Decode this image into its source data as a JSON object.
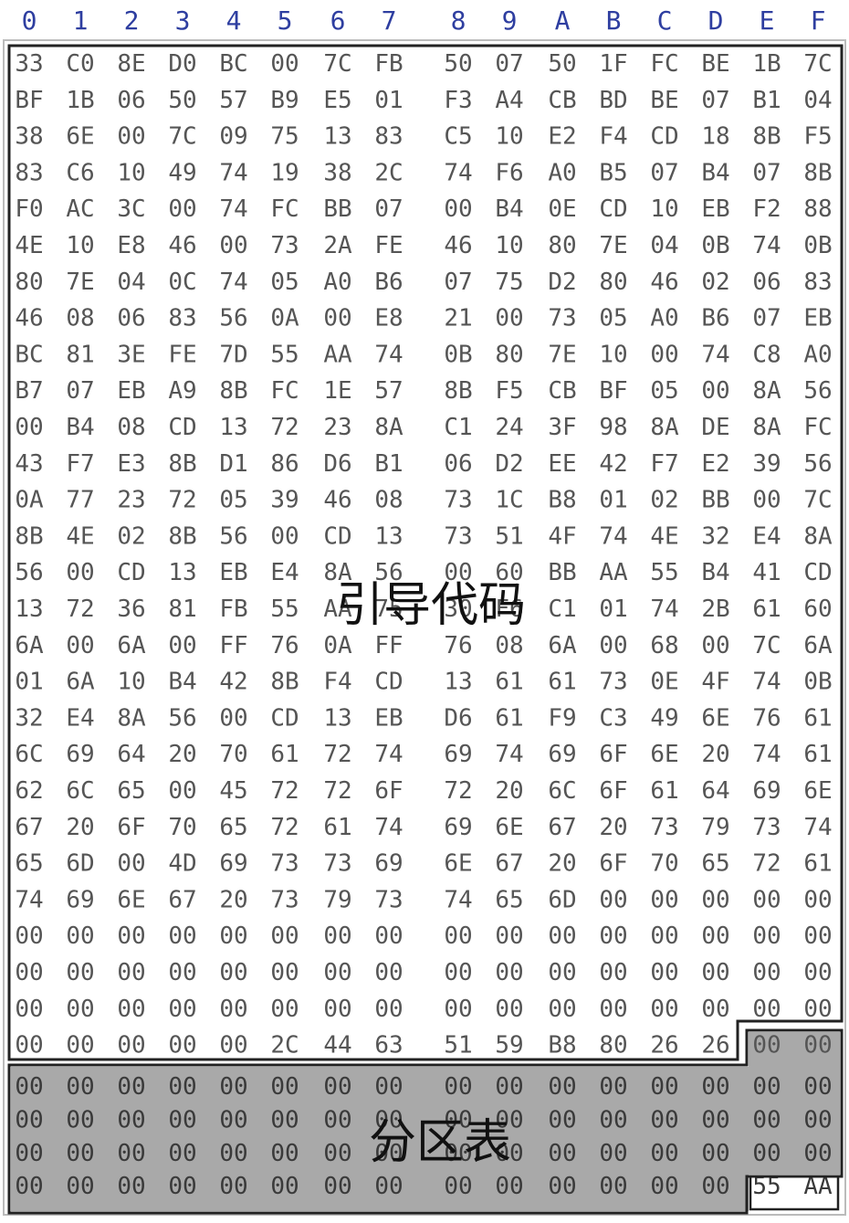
{
  "header": [
    "0",
    "1",
    "2",
    "3",
    "4",
    "5",
    "6",
    "7",
    "8",
    "9",
    "A",
    "B",
    "C",
    "D",
    "E",
    "F"
  ],
  "labels": {
    "boot_code": "引导代码",
    "partition_table": "分区表"
  },
  "rows": [
    [
      "33",
      "C0",
      "8E",
      "D0",
      "BC",
      "00",
      "7C",
      "FB",
      "50",
      "07",
      "50",
      "1F",
      "FC",
      "BE",
      "1B",
      "7C"
    ],
    [
      "BF",
      "1B",
      "06",
      "50",
      "57",
      "B9",
      "E5",
      "01",
      "F3",
      "A4",
      "CB",
      "BD",
      "BE",
      "07",
      "B1",
      "04"
    ],
    [
      "38",
      "6E",
      "00",
      "7C",
      "09",
      "75",
      "13",
      "83",
      "C5",
      "10",
      "E2",
      "F4",
      "CD",
      "18",
      "8B",
      "F5"
    ],
    [
      "83",
      "C6",
      "10",
      "49",
      "74",
      "19",
      "38",
      "2C",
      "74",
      "F6",
      "A0",
      "B5",
      "07",
      "B4",
      "07",
      "8B"
    ],
    [
      "F0",
      "AC",
      "3C",
      "00",
      "74",
      "FC",
      "BB",
      "07",
      "00",
      "B4",
      "0E",
      "CD",
      "10",
      "EB",
      "F2",
      "88"
    ],
    [
      "4E",
      "10",
      "E8",
      "46",
      "00",
      "73",
      "2A",
      "FE",
      "46",
      "10",
      "80",
      "7E",
      "04",
      "0B",
      "74",
      "0B"
    ],
    [
      "80",
      "7E",
      "04",
      "0C",
      "74",
      "05",
      "A0",
      "B6",
      "07",
      "75",
      "D2",
      "80",
      "46",
      "02",
      "06",
      "83"
    ],
    [
      "46",
      "08",
      "06",
      "83",
      "56",
      "0A",
      "00",
      "E8",
      "21",
      "00",
      "73",
      "05",
      "A0",
      "B6",
      "07",
      "EB"
    ],
    [
      "BC",
      "81",
      "3E",
      "FE",
      "7D",
      "55",
      "AA",
      "74",
      "0B",
      "80",
      "7E",
      "10",
      "00",
      "74",
      "C8",
      "A0"
    ],
    [
      "B7",
      "07",
      "EB",
      "A9",
      "8B",
      "FC",
      "1E",
      "57",
      "8B",
      "F5",
      "CB",
      "BF",
      "05",
      "00",
      "8A",
      "56"
    ],
    [
      "00",
      "B4",
      "08",
      "CD",
      "13",
      "72",
      "23",
      "8A",
      "C1",
      "24",
      "3F",
      "98",
      "8A",
      "DE",
      "8A",
      "FC"
    ],
    [
      "43",
      "F7",
      "E3",
      "8B",
      "D1",
      "86",
      "D6",
      "B1",
      "06",
      "D2",
      "EE",
      "42",
      "F7",
      "E2",
      "39",
      "56"
    ],
    [
      "0A",
      "77",
      "23",
      "72",
      "05",
      "39",
      "46",
      "08",
      "73",
      "1C",
      "B8",
      "01",
      "02",
      "BB",
      "00",
      "7C"
    ],
    [
      "8B",
      "4E",
      "02",
      "8B",
      "56",
      "00",
      "CD",
      "13",
      "73",
      "51",
      "4F",
      "74",
      "4E",
      "32",
      "E4",
      "8A"
    ],
    [
      "56",
      "00",
      "CD",
      "13",
      "EB",
      "E4",
      "8A",
      "56",
      "00",
      "60",
      "BB",
      "AA",
      "55",
      "B4",
      "41",
      "CD"
    ],
    [
      "13",
      "72",
      "36",
      "81",
      "FB",
      "55",
      "AA",
      "75",
      "30",
      "F6",
      "C1",
      "01",
      "74",
      "2B",
      "61",
      "60"
    ],
    [
      "6A",
      "00",
      "6A",
      "00",
      "FF",
      "76",
      "0A",
      "FF",
      "76",
      "08",
      "6A",
      "00",
      "68",
      "00",
      "7C",
      "6A"
    ],
    [
      "01",
      "6A",
      "10",
      "B4",
      "42",
      "8B",
      "F4",
      "CD",
      "13",
      "61",
      "61",
      "73",
      "0E",
      "4F",
      "74",
      "0B"
    ],
    [
      "32",
      "E4",
      "8A",
      "56",
      "00",
      "CD",
      "13",
      "EB",
      "D6",
      "61",
      "F9",
      "C3",
      "49",
      "6E",
      "76",
      "61"
    ],
    [
      "6C",
      "69",
      "64",
      "20",
      "70",
      "61",
      "72",
      "74",
      "69",
      "74",
      "69",
      "6F",
      "6E",
      "20",
      "74",
      "61"
    ],
    [
      "62",
      "6C",
      "65",
      "00",
      "45",
      "72",
      "72",
      "6F",
      "72",
      "20",
      "6C",
      "6F",
      "61",
      "64",
      "69",
      "6E"
    ],
    [
      "67",
      "20",
      "6F",
      "70",
      "65",
      "72",
      "61",
      "74",
      "69",
      "6E",
      "67",
      "20",
      "73",
      "79",
      "73",
      "74"
    ],
    [
      "65",
      "6D",
      "00",
      "4D",
      "69",
      "73",
      "73",
      "69",
      "6E",
      "67",
      "20",
      "6F",
      "70",
      "65",
      "72",
      "61"
    ],
    [
      "74",
      "69",
      "6E",
      "67",
      "20",
      "73",
      "79",
      "73",
      "74",
      "65",
      "6D",
      "00",
      "00",
      "00",
      "00",
      "00"
    ],
    [
      "00",
      "00",
      "00",
      "00",
      "00",
      "00",
      "00",
      "00",
      "00",
      "00",
      "00",
      "00",
      "00",
      "00",
      "00",
      "00"
    ],
    [
      "00",
      "00",
      "00",
      "00",
      "00",
      "00",
      "00",
      "00",
      "00",
      "00",
      "00",
      "00",
      "00",
      "00",
      "00",
      "00"
    ],
    [
      "00",
      "00",
      "00",
      "00",
      "00",
      "00",
      "00",
      "00",
      "00",
      "00",
      "00",
      "00",
      "00",
      "00",
      "00",
      "00"
    ],
    [
      "00",
      "00",
      "00",
      "00",
      "00",
      "2C",
      "44",
      "63",
      "51",
      "59",
      "B8",
      "80",
      "26",
      "26",
      "00",
      "00"
    ],
    [
      "00",
      "00",
      "00",
      "00",
      "00",
      "00",
      "00",
      "00",
      "00",
      "00",
      "00",
      "00",
      "00",
      "00",
      "00",
      "00"
    ],
    [
      "00",
      "00",
      "00",
      "00",
      "00",
      "00",
      "00",
      "00",
      "00",
      "00",
      "00",
      "00",
      "00",
      "00",
      "00",
      "00"
    ],
    [
      "00",
      "00",
      "00",
      "00",
      "00",
      "00",
      "00",
      "00",
      "00",
      "00",
      "00",
      "00",
      "00",
      "00",
      "00",
      "00"
    ],
    [
      "00",
      "00",
      "00",
      "00",
      "00",
      "00",
      "00",
      "00",
      "00",
      "00",
      "00",
      "00",
      "00",
      "00",
      "55",
      "AA"
    ]
  ],
  "colors": {
    "header": "#2e3ea0",
    "partition_fill": "#a9a9a9",
    "border": "#222222",
    "text": "#555555"
  }
}
